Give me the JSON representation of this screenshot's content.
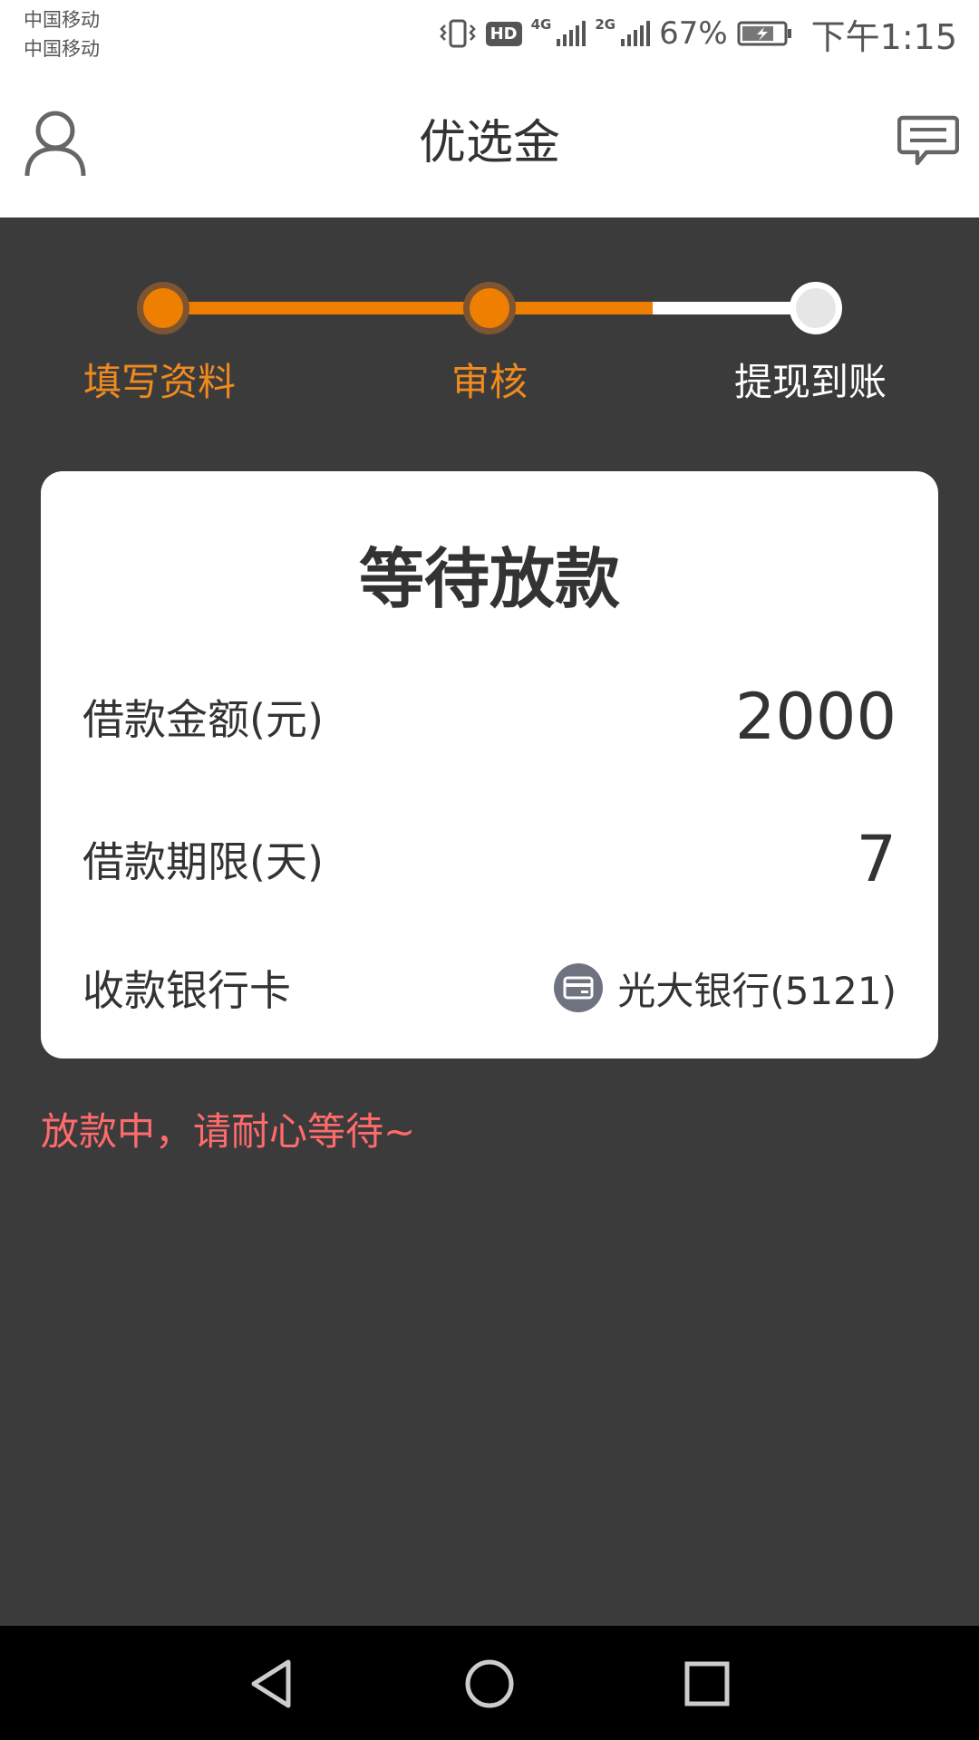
{
  "status_bar": {
    "carrier_1": "中国移动",
    "carrier_2": "中国移动",
    "hd": "HD",
    "network_1": "4G",
    "network_2": "2G",
    "battery_percent": "67%",
    "time": "下午1:15"
  },
  "header": {
    "title": "优选金",
    "left_icon": "user-icon",
    "right_icon": "message-icon"
  },
  "steps": [
    {
      "label": "填写资料",
      "state": "done"
    },
    {
      "label": "审核",
      "state": "done"
    },
    {
      "label": "提现到账",
      "state": "pending"
    }
  ],
  "card": {
    "title": "等待放款",
    "loan_amount_label": "借款金额(元)",
    "loan_amount_value": "2000",
    "loan_term_label": "借款期限(天)",
    "loan_term_value": "7",
    "bank_card_label": "收款银行卡",
    "bank_card_icon": "bank-card-icon",
    "bank_card_value": "光大银行(5121)"
  },
  "notice": "放款中，请耐心等待~",
  "colors": {
    "accent": "#ef7f00",
    "background": "#3c3b3c",
    "notice": "#ff6b6b"
  },
  "nav_bar": {
    "back_icon": "back-icon",
    "home_icon": "home-icon",
    "recents_icon": "recents-icon"
  }
}
